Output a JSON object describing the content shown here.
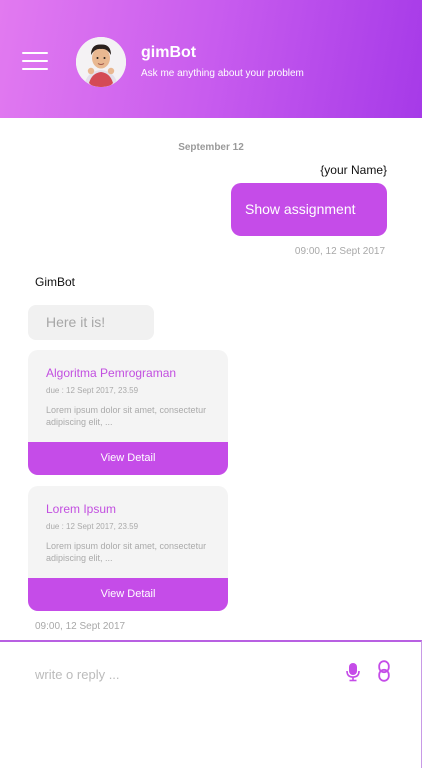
{
  "header": {
    "bot_name": "gimBot",
    "subtitle": "Ask me anything about your problem",
    "menu_icon": "hamburger-menu-icon",
    "avatar_icon": "bot-avatar"
  },
  "chat": {
    "date_separator": "September 12",
    "user_message": {
      "sender": "{your Name}",
      "text": "Show assignment",
      "time": "09:00, 12 Sept 2017"
    },
    "bot_message": {
      "sender": "GimBot",
      "text": "Here it is!",
      "time": "09:00, 12 Sept 2017"
    },
    "cards": [
      {
        "title": "Algoritma Pemrograman",
        "due": "due : 12 Sept 2017, 23.59",
        "description": "Lorem ipsum dolor sit amet, consectetur adipiscing elit, ...",
        "button": "View Detail"
      },
      {
        "title": "Lorem Ipsum",
        "due": "due : 12 Sept 2017, 23.59",
        "description": "Lorem ipsum dolor sit amet, consectetur adipiscing elit, ...",
        "button": "View Detail"
      }
    ]
  },
  "composer": {
    "placeholder": "write o reply ...",
    "value": "",
    "mic_icon": "microphone-icon",
    "attach_icon": "link-icon"
  },
  "colors": {
    "accent": "#c54ce8",
    "header_gradient_start": "#e27af0",
    "header_gradient_end": "#a63ae8",
    "bubble_gray": "#f1f1f1"
  }
}
